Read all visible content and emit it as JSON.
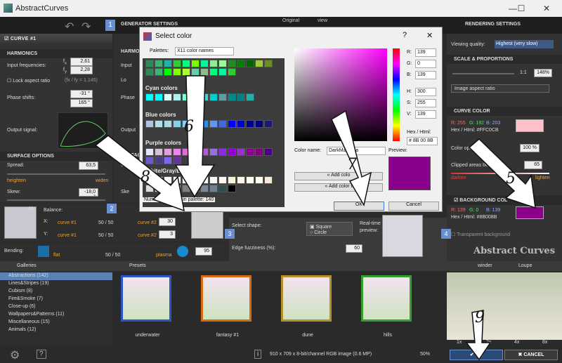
{
  "app": {
    "title": "AbstractCurves",
    "min": "—",
    "max": "☐",
    "close": "✕"
  },
  "generator": {
    "title": "GENERATOR SETTINGS",
    "badge": "1",
    "tab_original": "Original",
    "tab_view": "view"
  },
  "curve": {
    "title": "CURVE #1",
    "harmonics": "HARMONICS",
    "harmonics2": "HARMO",
    "input_freq": "Input frequencies:",
    "fx": "2,61",
    "fy": "2,28",
    "lock": "Lock aspect ratio",
    "ratio": "(fx / fy = 1.145)",
    "phase": "Phase shifts:",
    "px": "-31 °",
    "py": "165 °",
    "output": "Output signal:",
    "surface": "SURFACE OPTIONS",
    "surface2": "SURFAC",
    "spread": "Spread:",
    "spread_val": "63,5",
    "heighten": "heighten",
    "widen": "widen",
    "skew": "Skew:",
    "skew_val": "-18,0 °",
    "input_short": "Input",
    "lock_short": "Lo",
    "phase_short": "Phase",
    "output_short": "Output",
    "spread_short": "Sprea",
    "skew_short": "Ske"
  },
  "balance": {
    "label": "Balance:",
    "thumb_label": "#1",
    "x": "X:",
    "y": "Y:",
    "curve1": "curve #1",
    "curve2": "curve #2",
    "mid": "50 / 50",
    "x_val": "30",
    "y_val": "3",
    "badge": "2",
    "count": "Number of colors in palette: 140"
  },
  "bending": {
    "label": "Bending:",
    "flat": "flat",
    "mid": "50 / 50",
    "plasma": "plasma",
    "value": "95"
  },
  "shape": {
    "badge": "3",
    "label": "Select shape:",
    "square": "Square",
    "circle": "Circle",
    "fuzz": "Edge fuzziness (%):",
    "fuzz_val": "60",
    "realtime": "Real-time preview:"
  },
  "dialog": {
    "title": "Select color",
    "help": "?",
    "close": "✕",
    "palettes_label": "Palettes:",
    "palette": "X11 color names",
    "groups": [
      "Cyan colors",
      "Blue colors",
      "Purple colors",
      "White/Gray/Black colors"
    ],
    "add1": "Add colo",
    "add2": "Add color t",
    "r": "139",
    "g": "0",
    "b": "139",
    "h": "300",
    "s": "255",
    "v": "139",
    "hex_label": "Hex / Html:",
    "hex": "# 8B 00 8B",
    "name_label": "Color name:",
    "name": "DarkMagenta",
    "preview_label": "Preview:",
    "ok": "OK",
    "cancel": "Cancel",
    "R": "R:",
    "G": "G:",
    "B": "B:",
    "H": "H:",
    "S": "S:",
    "V": "V:",
    "add_prefix": "«"
  },
  "rendering": {
    "title": "RENDERING SETTINGS",
    "quality_label": "Viewing quality:",
    "quality": "Highest (very slow)",
    "scale": "SCALE & PROPORTIONS",
    "ratio": "1:1",
    "pct": "148%",
    "aspect": "Image aspect ratio",
    "curve_color": "CURVE COLOR",
    "cc_r": "R: 255",
    "cc_g": "G: 192",
    "cc_b": "B: 203",
    "cc_hex": "Hex / Html:  #FFC0CB",
    "opacity_label": "Color op",
    "opacity_suffix": "acity:",
    "opacity": "100 %",
    "clipped_label": "Clipped area",
    "clipped_suffix": "s boo",
    "clipped": "65",
    "darken": "darken",
    "lighten": "lighten",
    "bg": "BACKGROUND CO",
    "bg_suffix": "L",
    "bg_r": "R: 139",
    "bg_g": "G: 0",
    "bg_b": "B: 139",
    "bg_hex": "Hex / Html:  #8B008B",
    "transparent": "Transparent background",
    "badge": "4",
    "logo": "Abstract Curves"
  },
  "galleries": {
    "title": "Galleries",
    "items": [
      {
        "label": "Abstractions (142)",
        "sel": true
      },
      {
        "label": "Lines&Stripes (19)",
        "sel": false
      },
      {
        "label": "Cubism (8)",
        "sel": false
      },
      {
        "label": "Fire&Smoke (7)",
        "sel": false
      },
      {
        "label": "Close-up (6)",
        "sel": false
      },
      {
        "label": "Wallpapers&Patterns (11)",
        "sel": false
      },
      {
        "label": "Miscellaneous (15)",
        "sel": false
      },
      {
        "label": "Animals (12)",
        "sel": false
      }
    ]
  },
  "presets": {
    "title": "Presets",
    "names": [
      "underwater",
      "fantasy #1",
      "dune",
      "hills"
    ]
  },
  "preview": {
    "winder": "winder",
    "loupe": "Loupe",
    "zooms": [
      "1x",
      "2x",
      "4x",
      "8x"
    ],
    "ok": "OK",
    "cancel": "CANCEL"
  },
  "status": {
    "info": "910 x 709 x 8-bit/channel RGB image  (0.6 MP)",
    "zoom": "50%"
  },
  "annotations": [
    "1",
    "2",
    "3",
    "4",
    "5",
    "6",
    "7",
    "8",
    "9"
  ],
  "colors": {
    "accent": "#8B008B",
    "pink": "#FFC0CB"
  }
}
